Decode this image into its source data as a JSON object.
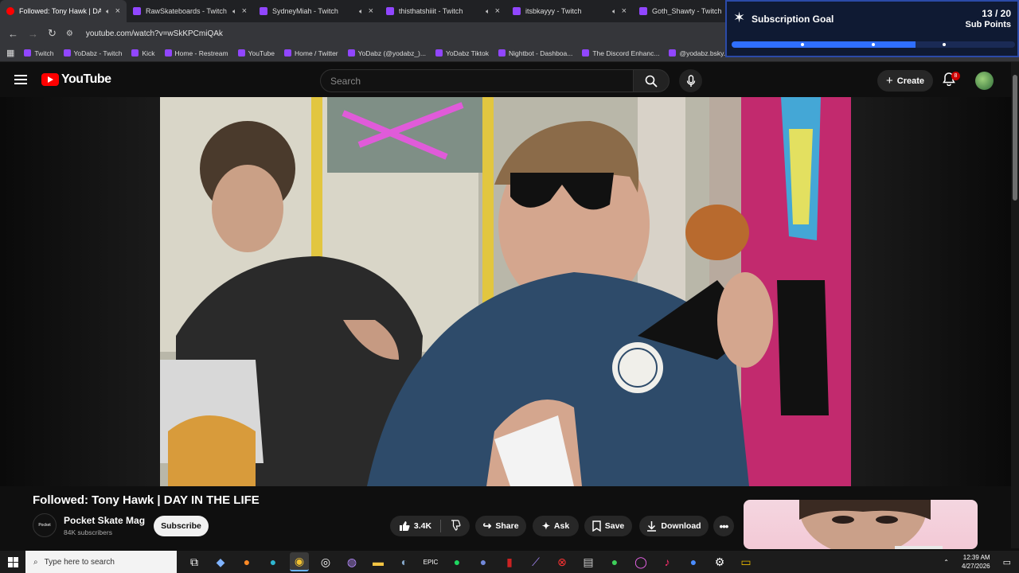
{
  "browser": {
    "tabs": [
      {
        "title": "Followed: Tony Hawk | DAY IN",
        "active": true
      },
      {
        "title": "RawSkateboards - Twitch",
        "active": false
      },
      {
        "title": "SydneyMiah - Twitch",
        "active": false
      },
      {
        "title": "thisthatshiiit - Twitch",
        "active": false
      },
      {
        "title": "itsbkayyy - Twitch",
        "active": false
      },
      {
        "title": "Goth_Shawty - Twitch",
        "active": false
      }
    ],
    "url": "youtube.com/watch?v=wSkKPCmiQAk",
    "bookmarks": [
      "Twitch",
      "YoDabz - Twitch",
      "Kick",
      "Home - Restream",
      "YouTube",
      "Home / Twitter",
      "YoDabz (@yodabz_)...",
      "YoDabz Tiktok",
      "Nightbot - Dashboa...",
      "The Discord Enhanc...",
      "@yodabz.bsky.socia..."
    ]
  },
  "goal_overlay": {
    "title": "Subscription Goal",
    "count": "13 / 20",
    "unit": "Sub Points",
    "progress": 0.65,
    "accent": "#2f6fff"
  },
  "youtube": {
    "logo_text": "YouTube",
    "search_placeholder": "Search",
    "create_label": "Create",
    "notification_count": "8"
  },
  "video": {
    "title": "Followed: Tony Hawk | DAY IN THE LIFE",
    "channel": "Pocket Skate Mag",
    "channel_avatar_text": "Pocket",
    "subscribers": "84K subscribers",
    "subscribe_label": "Subscribe",
    "likes": "3.4K",
    "share_label": "Share",
    "ask_label": "Ask",
    "save_label": "Save",
    "download_label": "Download"
  },
  "taskbar": {
    "search_placeholder": "Type here to search",
    "time": "12:39 AM",
    "date": "4/27/2026"
  }
}
